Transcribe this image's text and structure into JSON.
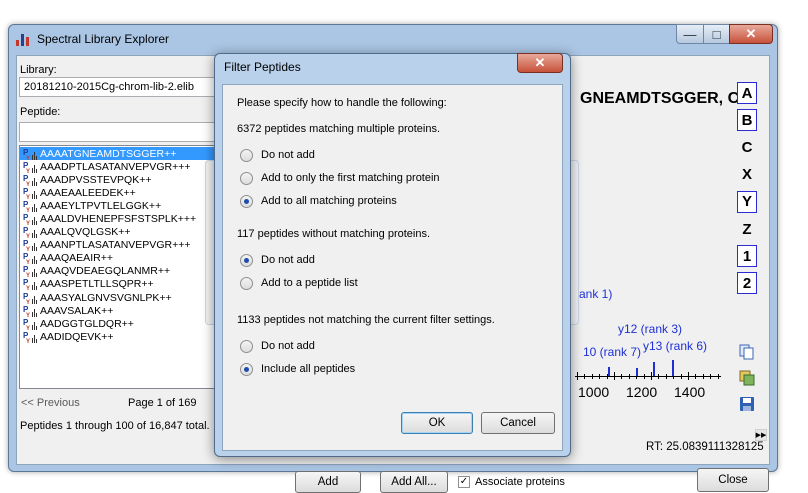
{
  "main_window": {
    "title": "Spectral Library Explorer",
    "library_label": "Library:",
    "library_value": "20181210-2015Cg-chrom-lib-2.elib",
    "peptide_label": "Peptide:",
    "peptide_search_value": "",
    "peptides": [
      "AAAATGNEAMDTSGGER++",
      "AAADPTLASATANVEPVGR+++",
      "AAADPVSSTEVPQK++",
      "AAAEAALEEDEK++",
      "AAAEYLTPVTLELGGK++",
      "AAALDVHENEPFSFSTSPLK+++",
      "AAALQVQLGSK++",
      "AAANPTLASATANVEPVGR+++",
      "AAAQAEAIR++",
      "AAAQVDEAEGQLANMR++",
      "AAASPETLTLLSQPR++",
      "AAASYALGNVSVGNLPK++",
      "AAAVSALAK++",
      "AADGGTGLDQR++",
      "AADIDQEVK++"
    ],
    "selected_index": 0,
    "previous_label": "<< Previous",
    "page_label": "Page 1 of 169",
    "summary": "Peptides 1 through 100 of 16,847 total.",
    "spectrum_title": "GNEAMDTSGGER, Ch",
    "ion_buttons": [
      {
        "label": "A",
        "boxed": true
      },
      {
        "label": "B",
        "boxed": true
      },
      {
        "label": "C",
        "boxed": false
      },
      {
        "label": "X",
        "boxed": false
      },
      {
        "label": "Y",
        "boxed": true
      },
      {
        "label": "Z",
        "boxed": false
      },
      {
        "label": "1",
        "boxed": true
      },
      {
        "label": "2",
        "boxed": true
      }
    ],
    "spectrum_labels": [
      "rank 1)",
      "y12 (rank 3)",
      "10 (rank 7)",
      "y13 (rank 6)"
    ],
    "x_ticks": [
      "1000",
      "1200",
      "1400"
    ],
    "rt_text": "RT: 25.0839111328125",
    "add_button": "Add",
    "add_all_button": "Add All...",
    "associate_label": "Associate proteins",
    "associate_checked": true,
    "close_button": "Close"
  },
  "dialog": {
    "title": "Filter Peptides",
    "instruction": "Please specify how to handle the following:",
    "groups": [
      {
        "heading": "6372 peptides matching multiple proteins.",
        "options": [
          "Do not add",
          "Add to only the first matching protein",
          "Add to all matching proteins"
        ],
        "selected": 2
      },
      {
        "heading": "117 peptides without matching proteins.",
        "options": [
          "Do not add",
          "Add to a peptide list"
        ],
        "selected": 0
      },
      {
        "heading": "1133 peptides not matching the current filter settings.",
        "options": [
          "Do not add",
          "Include all peptides"
        ],
        "selected": 1
      }
    ],
    "ok_button": "OK",
    "cancel_button": "Cancel"
  }
}
